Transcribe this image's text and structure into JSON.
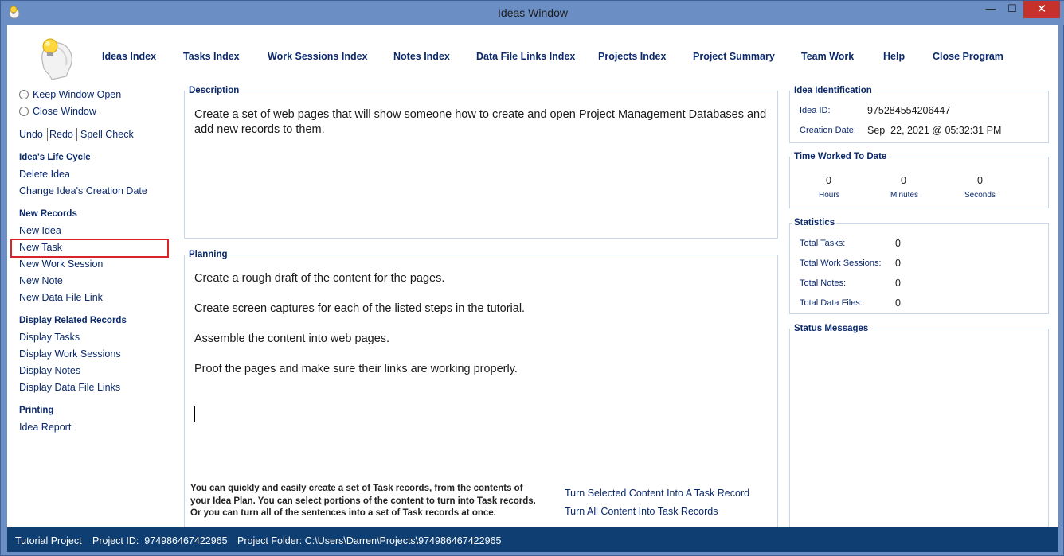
{
  "window": {
    "title": "Ideas Window",
    "minimize_glyph": "—",
    "maximize_glyph": "☐",
    "close_glyph": "✕"
  },
  "nav": {
    "items": [
      "Ideas Index",
      "Tasks Index",
      "Work Sessions Index",
      "Notes Index",
      "Data File Links Index",
      "Projects Index",
      "Project Summary",
      "Team Work",
      "Help",
      "Close Program"
    ]
  },
  "sidebar": {
    "keep_open": "Keep Window Open",
    "close_window": "Close Window",
    "undo": "Undo",
    "redo": "Redo",
    "spell_check": "Spell Check",
    "lifecycle_header": "Idea's Life Cycle",
    "delete_idea": "Delete Idea",
    "change_date": "Change Idea's Creation Date",
    "new_records_header": "New Records",
    "new_idea": "New Idea",
    "new_task": "New Task",
    "new_work_session": "New Work Session",
    "new_note": "New Note",
    "new_data_file_link": "New Data File Link",
    "related_header": "Display Related Records",
    "display_tasks": "Display Tasks",
    "display_work_sessions": "Display Work Sessions",
    "display_notes": "Display Notes",
    "display_data_file_links": "Display Data File Links",
    "printing_header": "Printing",
    "idea_report": "Idea Report",
    "highlight_color": "#d9232a"
  },
  "description": {
    "label": "Description",
    "text": "Create a set of web pages that will show someone how to create and open Project Management Databases and add new records to them."
  },
  "planning": {
    "label": "Planning",
    "lines": [
      "Create a rough draft of the content for the pages.",
      "Create screen captures for each of the listed steps in the tutorial.",
      "Assemble the content into web pages.",
      "Proof the pages and make sure their links are working properly."
    ],
    "note_lines": [
      "You can quickly and easily create a set of Task records, from the contents of",
      "your Idea Plan. You can select portions of the content to turn into Task records.",
      "Or you can turn all of the sentences into a set of Task records at once."
    ],
    "turn_selected": "Turn Selected Content Into A Task Record",
    "turn_all": "Turn All Content Into Task Records"
  },
  "identification": {
    "label": "Idea Identification",
    "id_label": "Idea ID:",
    "id_value": "975284554206447",
    "date_label": "Creation Date:",
    "date_value": "Sep  22, 2021 @ 05:32:31 PM"
  },
  "time_worked": {
    "label": "Time Worked To Date",
    "hours": "0",
    "minutes": "0",
    "seconds": "0",
    "hours_label": "Hours",
    "minutes_label": "Minutes",
    "seconds_label": "Seconds"
  },
  "statistics": {
    "label": "Statistics",
    "rows": [
      {
        "label": "Total Tasks:",
        "value": "0"
      },
      {
        "label": "Total Work Sessions:",
        "value": "0"
      },
      {
        "label": "Total Notes:",
        "value": "0"
      },
      {
        "label": "Total Data Files:",
        "value": "0"
      }
    ]
  },
  "status_messages": {
    "label": "Status Messages"
  },
  "statusbar": {
    "project": "Tutorial Project",
    "project_id": "Project ID:  974986467422965",
    "folder": "Project Folder: C:\\Users\\Darren\\Projects\\974986467422965"
  },
  "colors": {
    "title_bar": "#6b8ec4",
    "status_bar": "#0f3e73",
    "link_text": "#0b2a6b",
    "close_button": "#c7312c"
  },
  "icons": {
    "app": "lightbulb-head-icon",
    "logo": "lightbulb-head-logo-icon"
  }
}
